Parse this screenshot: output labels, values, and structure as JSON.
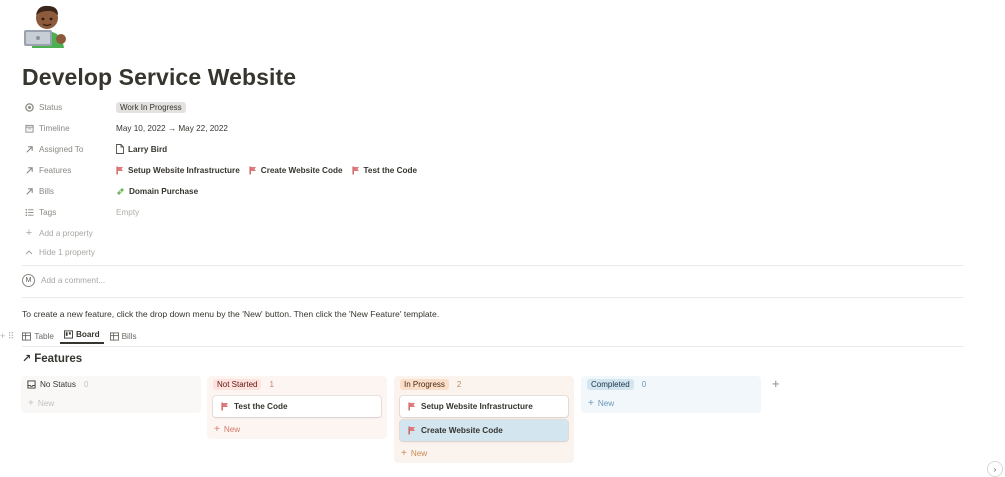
{
  "page": {
    "title": "Develop Service Website",
    "avatar_icon": "person-with-laptop-icon"
  },
  "properties": {
    "status": {
      "label": "Status",
      "value": "Work In Progress"
    },
    "timeline": {
      "label": "Timeline",
      "value": "May 10, 2022 → May 22, 2022"
    },
    "assigned_to": {
      "label": "Assigned To",
      "value": "Larry Bird"
    },
    "features": {
      "label": "Features",
      "items": [
        "Setup Website Infrastructure",
        "Create Website Code",
        "Test the Code"
      ]
    },
    "bills": {
      "label": "Bills",
      "items": [
        "Domain Purchase"
      ]
    },
    "tags": {
      "label": "Tags",
      "value": "Empty"
    },
    "add_property": "Add a property",
    "hide_property": "Hide 1 property"
  },
  "comment": {
    "avatar_letter": "M",
    "placeholder": "Add a comment..."
  },
  "info_text": "To create a new feature, click the drop down menu by the 'New' button. Then click the 'New Feature' template.",
  "views": {
    "tabs": [
      "Table",
      "Board",
      "Bills"
    ],
    "active": "Board"
  },
  "database": {
    "title": "Features"
  },
  "board": {
    "columns": [
      {
        "name": "No Status",
        "count": "0",
        "cards": [],
        "new_label": "New"
      },
      {
        "name": "Not Started",
        "count": "1",
        "cards": [
          "Test the Code"
        ],
        "new_label": "New"
      },
      {
        "name": "In Progress",
        "count": "2",
        "cards": [
          "Setup Website Infrastructure",
          "Create Website Code"
        ],
        "new_label": "New"
      },
      {
        "name": "Completed",
        "count": "0",
        "cards": [],
        "new_label": "New"
      }
    ],
    "add_group": "+"
  },
  "colors": {
    "text": "#37352f",
    "muted": "#8a8883",
    "status_pill": "#e3e2e0",
    "not_started_bg": "#fdf5f2",
    "not_started_tag": "#ffe2dd",
    "in_progress_bg": "#fbf3ee",
    "in_progress_tag": "#fadec9",
    "completed_bg": "#f1f7fb",
    "completed_tag": "#d3e5ef",
    "no_status_bg": "#f9f8f7",
    "selected_card": "#d3e5ef"
  }
}
